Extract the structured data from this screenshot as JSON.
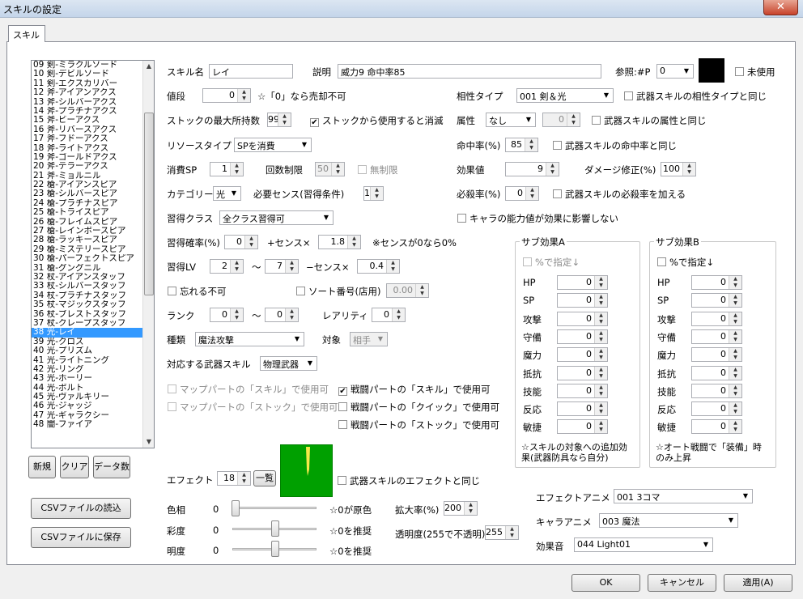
{
  "window": {
    "title": "スキルの設定",
    "close": "✕"
  },
  "tab": {
    "label": "スキル"
  },
  "list": {
    "items": [
      "09 剣-ミラクルソード",
      "10 剣-デビルソード",
      "11 剣-エクスカリバー",
      "12 斧-アイアンアクス",
      "13 斧-シルバーアクス",
      "14 斧-プラチナアクス",
      "15 斧-ビーアクス",
      "16 斧-リバースアクス",
      "17 斧-フドーアクス",
      "18 斧-ライトアクス",
      "19 斧-ゴールドアクス",
      "20 斧-テラーアクス",
      "21 斧-ミョルニル",
      "22 槍-アイアンスピア",
      "23 槍-シルバースピア",
      "24 槍-プラチナスピア",
      "25 槍-トライスピア",
      "26 槍-フレイムスピア",
      "27 槍-レインボースピア",
      "28 槍-ラッキースピア",
      "29 槍-ミステリースピア",
      "30 槍-パーフェクトスピア",
      "31 槍-グングニル",
      "32 杖-アイアンスタッフ",
      "33 杖-シルバースタッフ",
      "34 杖-プラチナスタッフ",
      "35 杖-マジックスタッフ",
      "36 杖-ブレストスタッフ",
      "37 杖-クレープスタッフ",
      "38 光-レイ",
      "39 光-クロス",
      "40 光-プリズム",
      "41 光-ライトニング",
      "42 光-リング",
      "43 光-ホーリー",
      "44 光-ボルト",
      "45 光-ヴァルキリー",
      "46 光-ジャッジ",
      "47 光-ギャラクシー",
      "48 闇-ファイア"
    ],
    "selected_index": 29
  },
  "left_buttons": {
    "new": "新規",
    "clear": "クリア",
    "data_count": "データ数",
    "csv_load": "CSVファイルの読込",
    "csv_save": "CSVファイルに保存"
  },
  "form": {
    "name_label": "スキル名",
    "name_value": "レイ",
    "desc_label": "説明",
    "desc_value": "威力9  命中率85",
    "ref_label": "参照:#P",
    "ref_value": "0",
    "unused_label": "未使用",
    "price_label": "値段",
    "price_value": "0",
    "price_note": "☆「0」なら売却不可",
    "affinity_label": "相性タイプ",
    "affinity_value": "001 剣＆光",
    "affinity_same": "武器スキルの相性タイプと同じ",
    "stock_label": "ストックの最大所持数",
    "stock_value": "99",
    "stock_consume": "ストックから使用すると消滅",
    "attr_label": "属性",
    "attr_value": "なし",
    "attr_num": "0",
    "attr_same": "武器スキルの属性と同じ",
    "resource_label": "リソースタイプ",
    "resource_value": "SPを消費",
    "hit_label": "命中率(%)",
    "hit_value": "85",
    "hit_same": "武器スキルの命中率と同じ",
    "sp_label": "消費SP",
    "sp_value": "1",
    "limit_label": "回数制限",
    "limit_value": "50",
    "unlimited_label": "無制限",
    "effect_val_label": "効果値",
    "effect_val_value": "9",
    "dmg_mod_label": "ダメージ修正(%)",
    "dmg_mod_value": "100",
    "category_label": "カテゴリー",
    "category_value": "光",
    "sense_req_label": "必要センス(習得条件)",
    "sense_req_value": "1",
    "crit_label": "必殺率(%)",
    "crit_value": "0",
    "crit_add": "武器スキルの必殺率を加える",
    "learn_class_label": "習得クラス",
    "learn_class_value": "全クラス習得可",
    "chara_ability": "キャラの能力値が効果に影響しない",
    "learn_rate_label": "習得確率(%)",
    "learn_rate_value": "0",
    "learn_rate_sense": "+センス×",
    "learn_rate_mult": "1.8",
    "learn_rate_note": "※センスが0なら0%",
    "learn_lv_label": "習得LV",
    "learn_lv_min": "2",
    "tilde": "〜",
    "learn_lv_max": "7",
    "minus_sense": "−センス×",
    "learn_lv_mult": "0.4",
    "unforget": "忘れる不可",
    "sort_label": "ソート番号(店用)",
    "sort_value": "0.00",
    "rank_label": "ランク",
    "rank_min": "0",
    "rank_max": "0",
    "rarity_label": "レアリティ",
    "rarity_value": "0",
    "kind_label": "種類",
    "kind_value": "魔法攻撃",
    "target_label": "対象",
    "target_value": "相手",
    "weapon_skill_label": "対応する武器スキル",
    "weapon_skill_value": "物理武器",
    "map_skill": "マップパートの「スキル」で使用可",
    "map_stock": "マップパートの「ストック」で使用可",
    "battle_skill": "戦闘パートの「スキル」で使用可",
    "battle_quick": "戦闘パートの「クイック」で使用可",
    "battle_stock": "戦闘パートの「ストック」で使用可",
    "effect_label": "エフェクト",
    "effect_value": "18",
    "effect_list": "一覧",
    "effect_same": "武器スキルのエフェクトと同じ",
    "hue_label": "色相",
    "hue_value": "0",
    "hue_note": "☆0が原色",
    "sat_label": "彩度",
    "sat_value": "0",
    "sat_note": "☆0を推奨",
    "bri_label": "明度",
    "bri_value": "0",
    "bri_note": "☆0を推奨",
    "scale_label": "拡大率(%)",
    "scale_value": "200",
    "opacity_label": "透明度(255で不透明)",
    "opacity_value": "255",
    "effect_anim_label": "エフェクトアニメ",
    "effect_anim_value": "001 3コマ",
    "chara_anim_label": "キャラアニメ",
    "chara_anim_value": "003 魔法",
    "sound_label": "効果音",
    "sound_value": "044 Light01"
  },
  "sub_a": {
    "title": "サブ効果A",
    "pct": "%で指定↓",
    "stats": [
      "HP",
      "SP",
      "攻撃",
      "守備",
      "魔力",
      "抵抗",
      "技能",
      "反応",
      "敏捷"
    ],
    "values": [
      "0",
      "0",
      "0",
      "0",
      "0",
      "0",
      "0",
      "0",
      "0"
    ],
    "note": "☆スキルの対象への追加効果(武器防具なら自分)"
  },
  "sub_b": {
    "title": "サブ効果B",
    "pct": "%で指定↓",
    "stats": [
      "HP",
      "SP",
      "攻撃",
      "守備",
      "魔力",
      "抵抗",
      "技能",
      "反応",
      "敏捷"
    ],
    "values": [
      "0",
      "0",
      "0",
      "0",
      "0",
      "0",
      "0",
      "0",
      "0"
    ],
    "note": "☆オート戦闘で「装備」時のみ上昇"
  },
  "footer": {
    "ok": "OK",
    "cancel": "キャンセル",
    "apply": "適用(A)"
  }
}
